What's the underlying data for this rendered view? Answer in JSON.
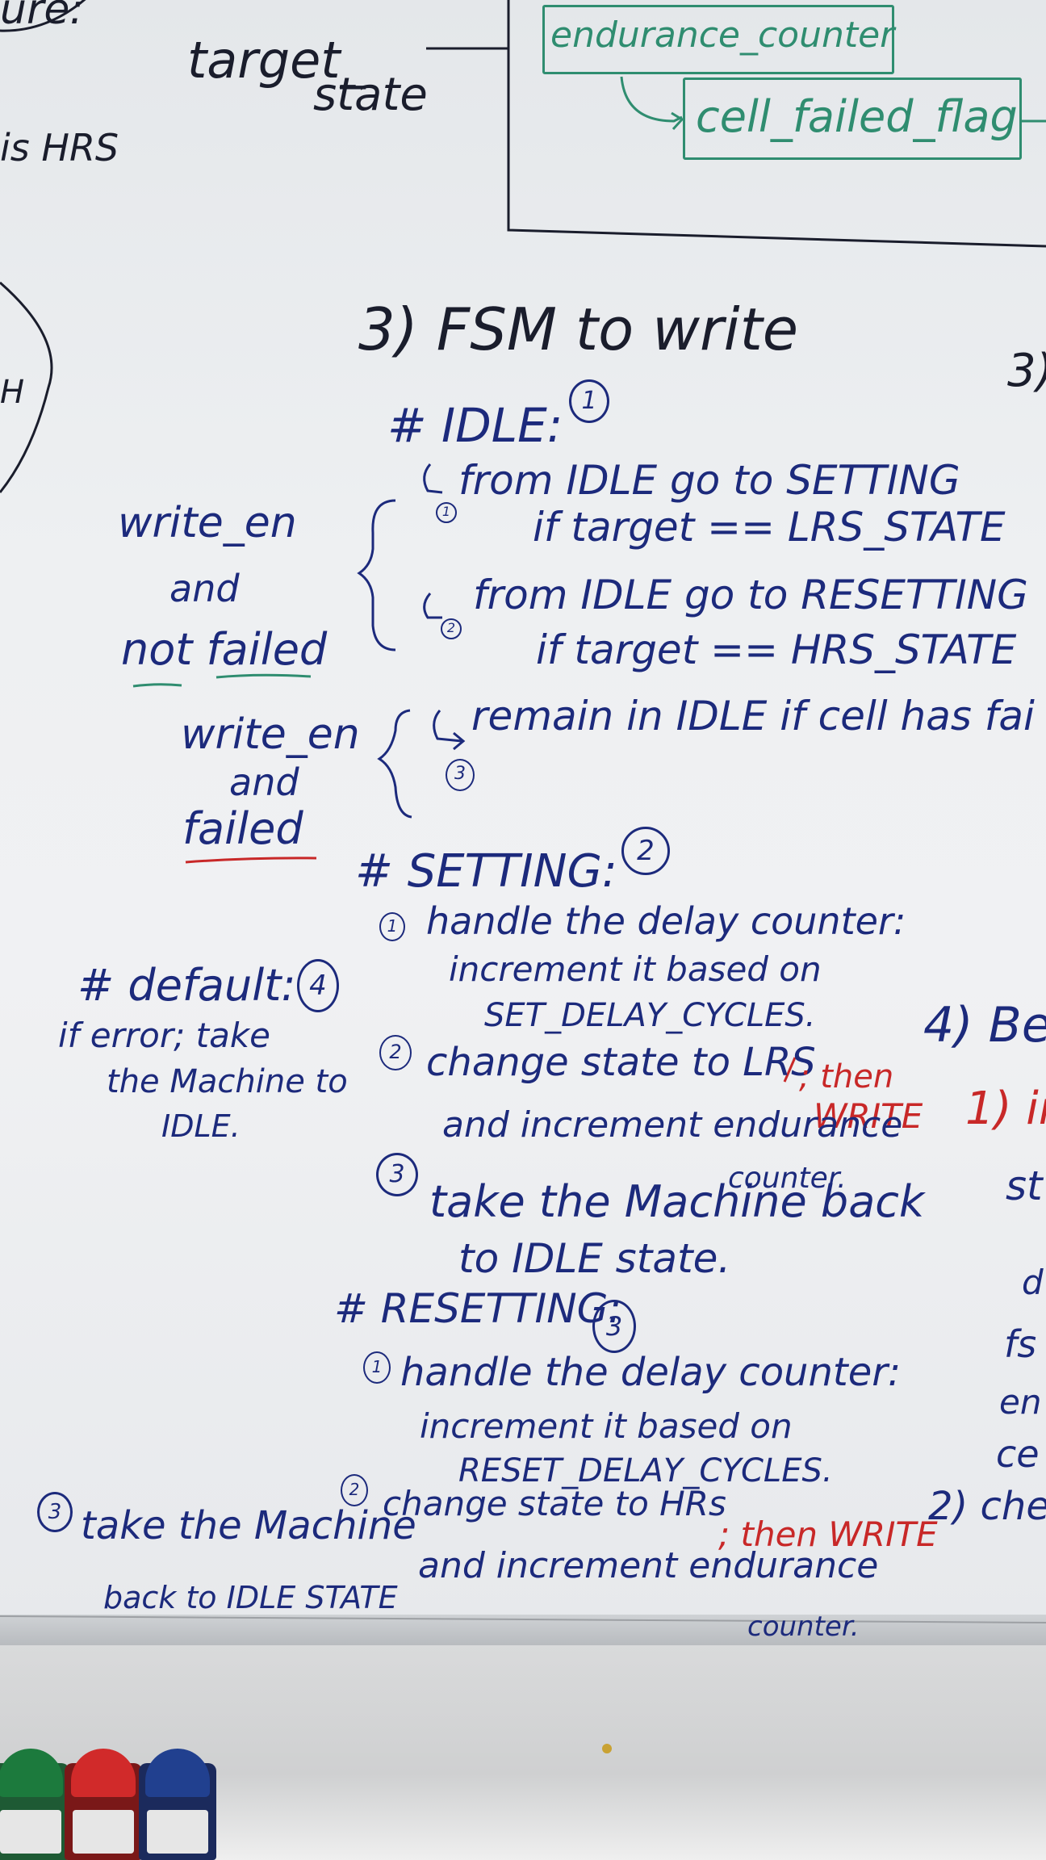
{
  "top": {
    "ure": "ure:",
    "target_state": [
      "target_",
      "state"
    ],
    "is_hrs": "is HRS",
    "endurance_counter": "endurance_counter",
    "cell_failed_flag": "cell_failed_flag"
  },
  "fsm": {
    "title": "3) FSM to write",
    "right_marker": "3)",
    "left_circle_letter": "H",
    "idle": {
      "header": "# IDLE:",
      "badge": "1",
      "line1": "from IDLE go to SETTING",
      "line1_num": "1",
      "line2": "if target == LRS_STATE",
      "line3": "from IDLE go to RESETTING",
      "line3_num": "2",
      "line4": "if target == HRS_STATE",
      "line5": "remain in IDLE if cell has fai",
      "line5_num": "3"
    },
    "conditions": {
      "a1": "write_en",
      "a2": "and",
      "a3": "not failed",
      "b1": "write_en",
      "b2": "and",
      "b3": "failed"
    },
    "setting": {
      "header": "# SETTING:",
      "badge": "2",
      "s1_num": "1",
      "s1a": "handle the delay counter:",
      "s1b": "increment it based on",
      "s1c": "SET_DELAY_CYCLES.",
      "s2_num": "2",
      "s2a": "change state to LRS",
      "s2_red1": "; then",
      "s2_red2": "WRITE",
      "s2b": "and increment endurance",
      "s2c": "counter.",
      "s3_num": "3",
      "s3a": "take the Machine back",
      "s3b": "to IDLE state."
    },
    "default": {
      "header": "# default:",
      "badge": "4",
      "l1": "if error; take",
      "l2": "the Machine to",
      "l3": "IDLE."
    },
    "resetting": {
      "header": "# RESETTING:",
      "badge": "3",
      "r1_num": "1",
      "r1a": "handle the delay counter:",
      "r1b": "increment it based on",
      "r1c": "RESET_DELAY_CYCLES.",
      "r2_num": "2",
      "r2a": "change state to HRs",
      "r2_red": "; then WRITE",
      "r2b": "and increment endurance",
      "r2c": "counter.",
      "r3_num": "3",
      "r3a": "take the Machine",
      "r3b": "back to IDLE STATE"
    },
    "right": {
      "be": "4) Be",
      "in": "1) in",
      "st": "st",
      "d": "d",
      "fs": "fs",
      "en": "en",
      "ce": "ce",
      "che": "2) che"
    }
  },
  "colors": {
    "blue_ink": "#1c2a7c",
    "red_ink": "#c82828",
    "green_ink": "#2f8d70",
    "board": "#eef0f2"
  },
  "markers": [
    "green",
    "red",
    "blue"
  ]
}
